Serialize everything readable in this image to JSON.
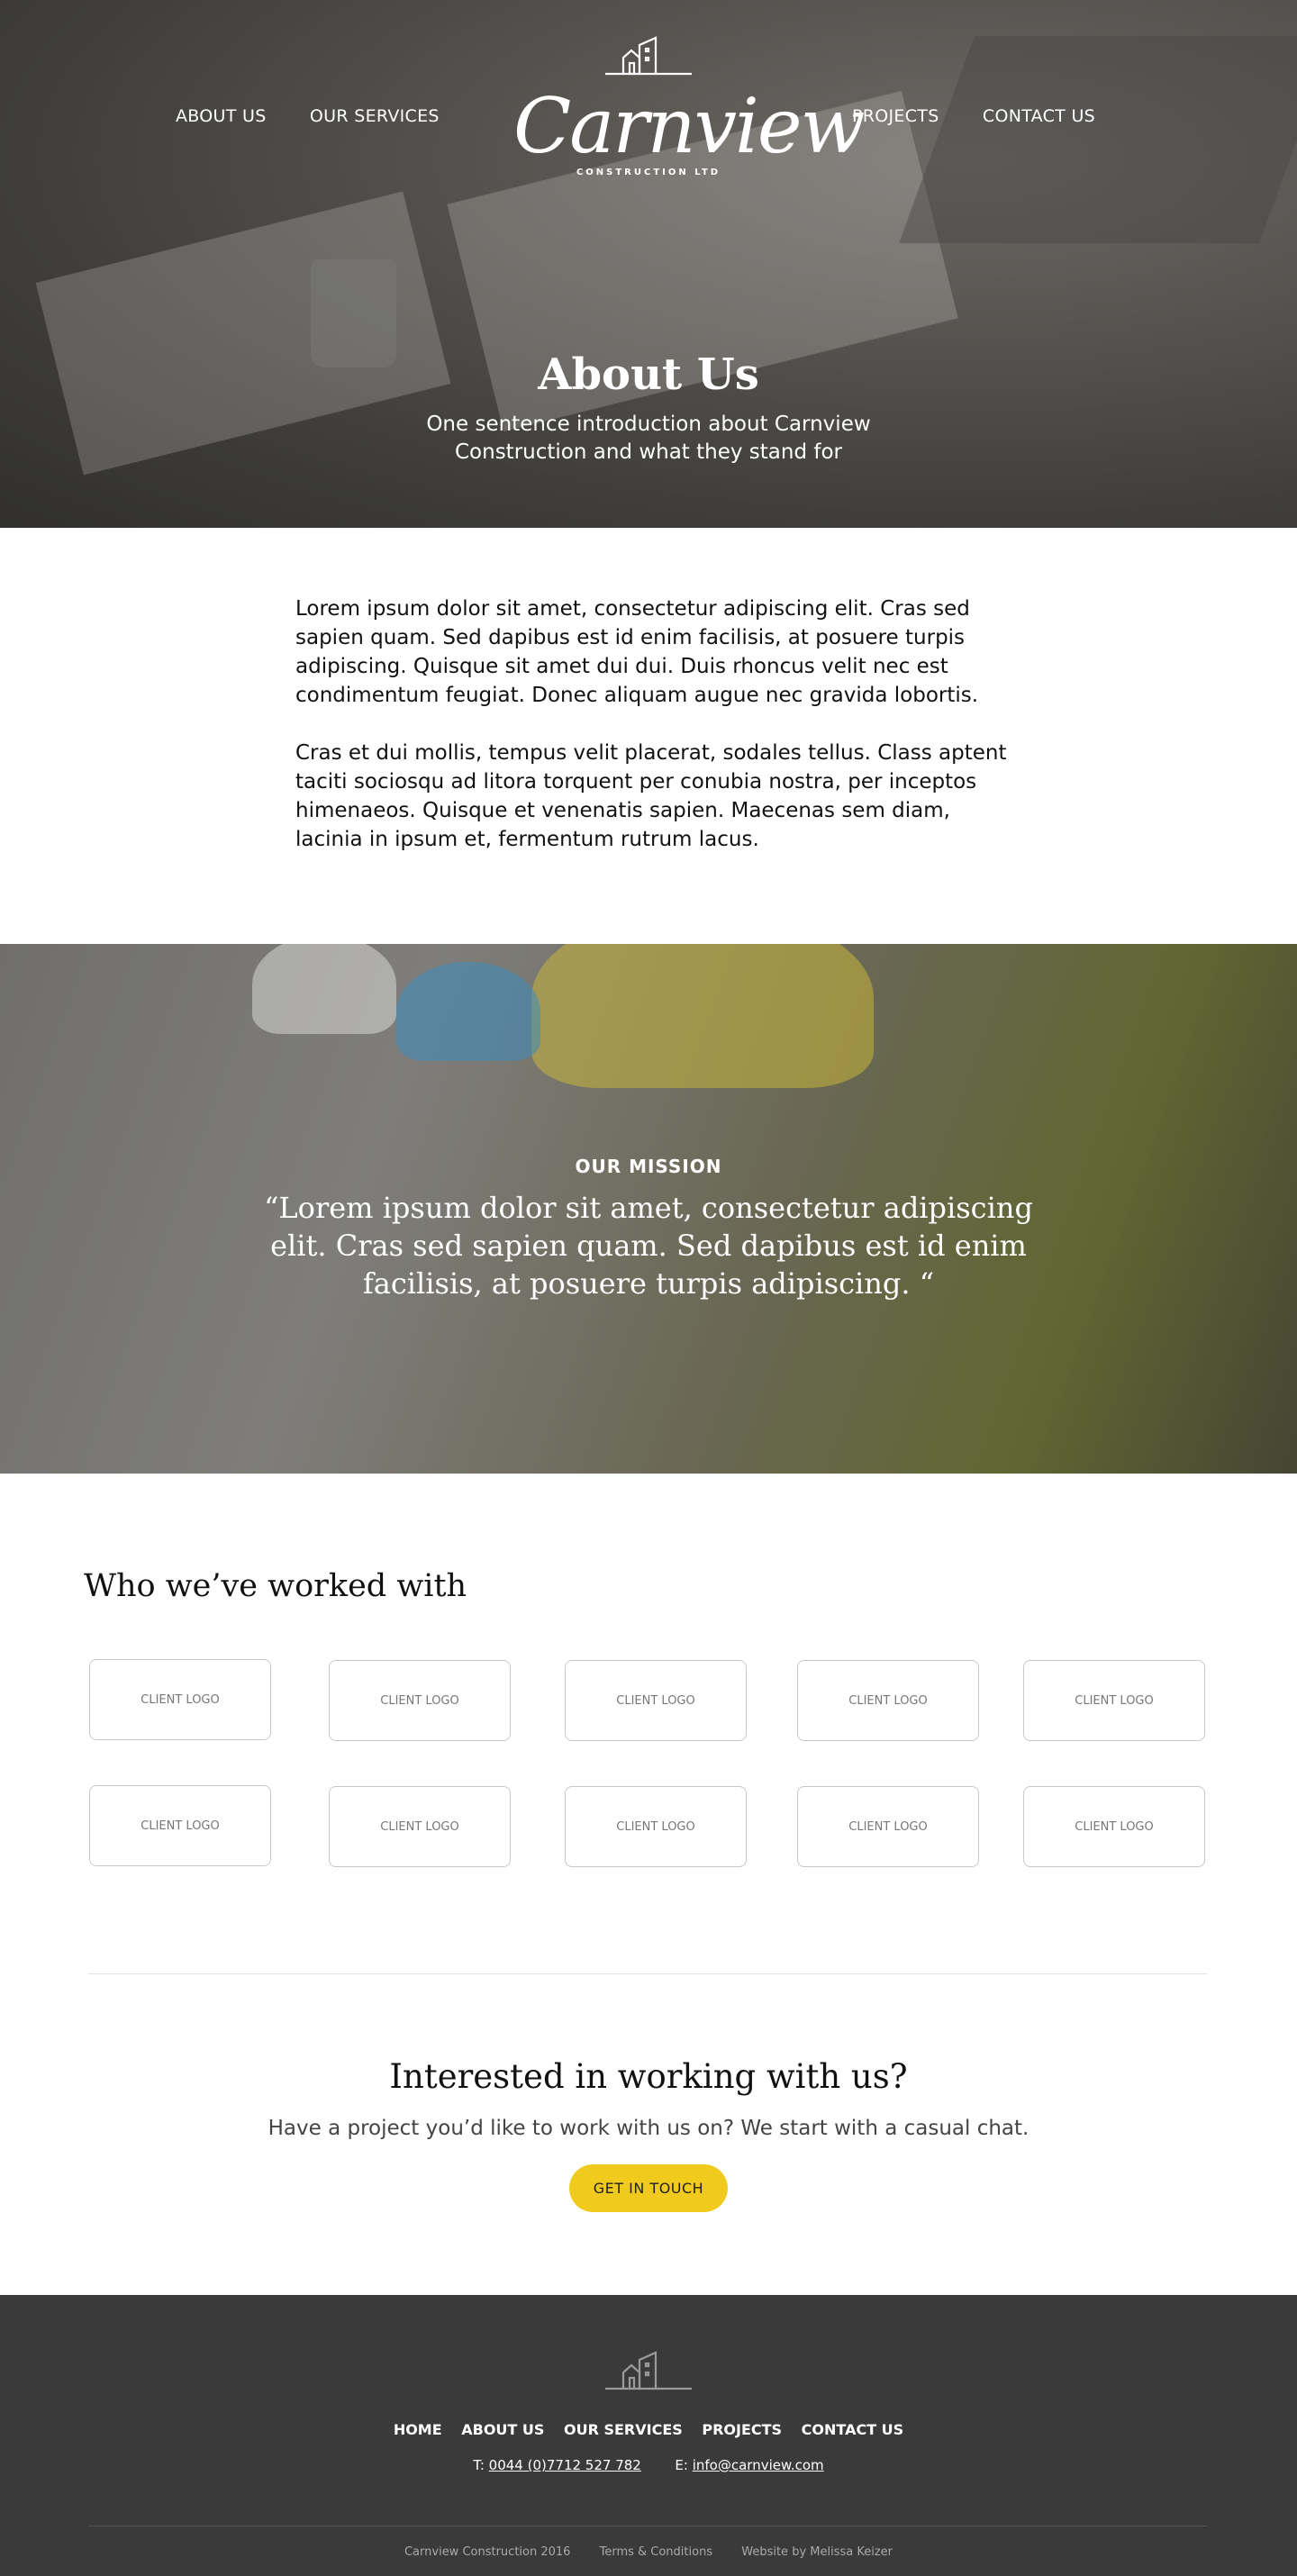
{
  "nav": {
    "left": [
      "ABOUT US",
      "OUR SERVICES"
    ],
    "right": [
      "PROJECTS",
      "CONTACT US"
    ]
  },
  "logo": {
    "wordmark": "Carnview",
    "subtitle": "CONSTRUCTION LTD",
    "icon": "building-icon"
  },
  "hero": {
    "title": "About Us",
    "subtitle": "One sentence introduction about Carnview Construction and what they stand for"
  },
  "intro": {
    "paragraphs": [
      "Lorem ipsum dolor sit amet, consectetur adipiscing elit. Cras sed sapien quam. Sed dapibus est id enim facilisis, at posuere turpis adipiscing. Quisque sit amet dui dui. Duis rhoncus velit nec est condimentum feugiat. Donec aliquam augue nec gravida lobortis.",
      "Cras et dui mollis, tempus velit placerat, sodales tellus. Class aptent taciti sociosqu ad litora torquent per conubia nostra, per inceptos himenaeos. Quisque et venenatis sapien. Maecenas sem diam, lacinia in ipsum et, fermentum rutrum lacus."
    ]
  },
  "mission": {
    "label": "OUR MISSION",
    "quote": "“Lorem ipsum dolor sit amet, consectetur adipiscing elit. Cras sed sapien quam. Sed dapibus est id enim facilisis, at posuere turpis adipiscing. “"
  },
  "clients": {
    "heading": "Who we’ve worked with",
    "logos": [
      "CLIENT LOGO",
      "CLIENT LOGO",
      "CLIENT LOGO",
      "CLIENT LOGO",
      "CLIENT LOGO",
      "CLIENT LOGO",
      "CLIENT LOGO",
      "CLIENT LOGO",
      "CLIENT LOGO",
      "CLIENT LOGO"
    ]
  },
  "cta": {
    "heading": "Interested in working with us?",
    "text": "Have a project you’d like to work with us on? We start with a casual chat.",
    "button": "GET IN TOUCH",
    "button_color": "#f0cb1e"
  },
  "footer": {
    "nav": [
      "HOME",
      "ABOUT US",
      "OUR SERVICES",
      "PROJECTS",
      "CONTACT US"
    ],
    "phone_label": "T:",
    "phone": "0044 (0)7712 527 782",
    "email_label": "E:",
    "email": "info@carnview.com",
    "copyright": "Carnview Construction 2016",
    "terms": "Terms & Conditions",
    "credit": "Website by Melissa Keizer",
    "background": "#3a3a3a"
  }
}
